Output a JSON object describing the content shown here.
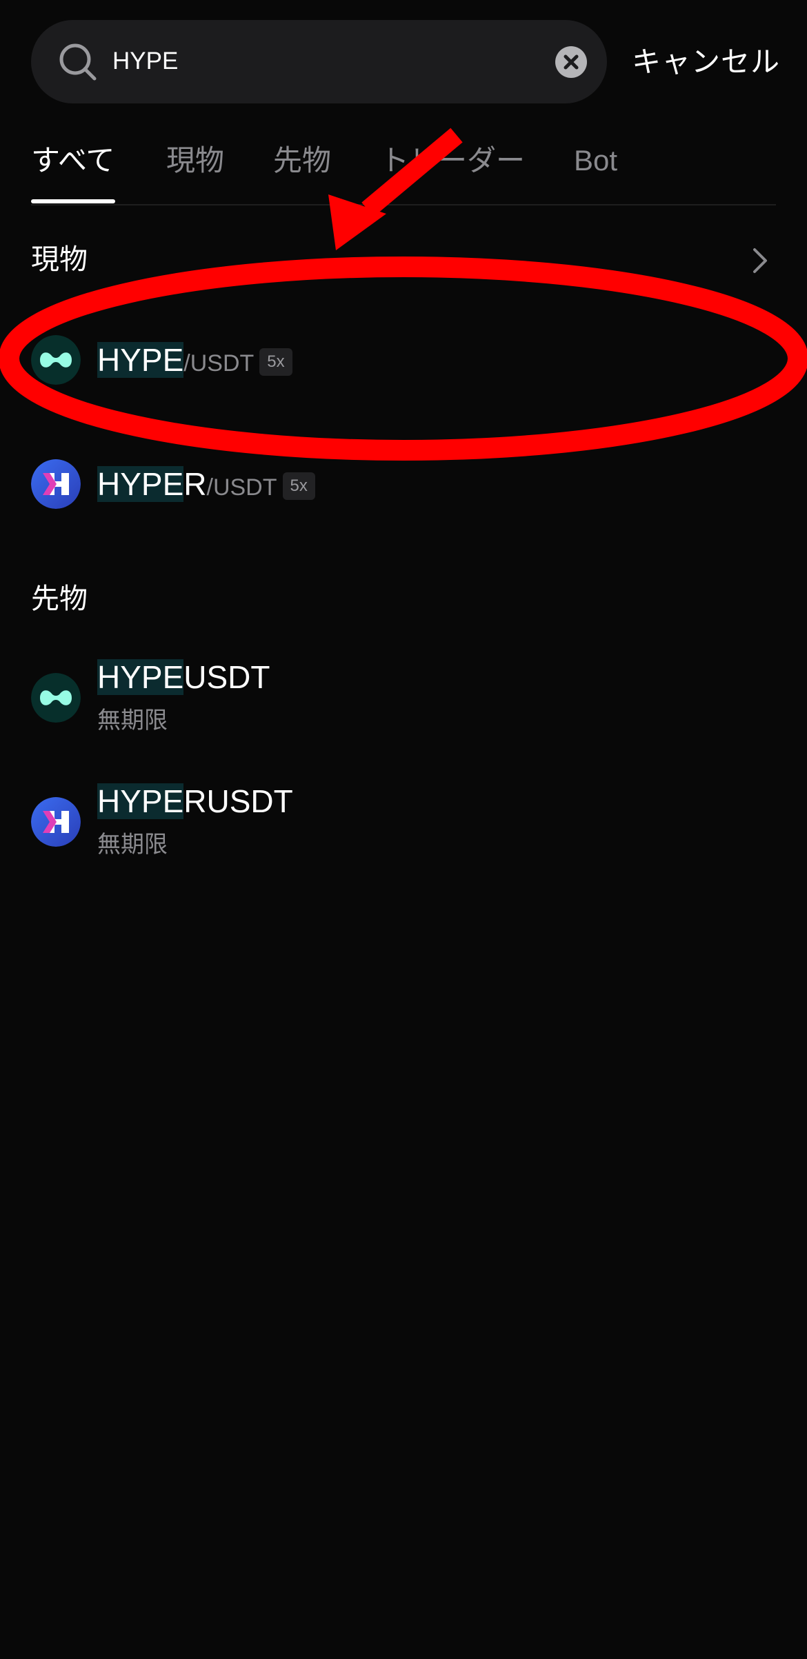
{
  "search": {
    "value": "HYPE",
    "cancel_label": "キャンセル"
  },
  "tabs": [
    {
      "label": "すべて",
      "active": true
    },
    {
      "label": "現物",
      "active": false
    },
    {
      "label": "先物",
      "active": false
    },
    {
      "label": "トレーダー",
      "active": false
    },
    {
      "label": "Bot",
      "active": false
    }
  ],
  "spot": {
    "title": "現物",
    "items": [
      {
        "highlight": "HYPE",
        "rest": "",
        "quote": "/USDT",
        "leverage": "5x",
        "icon": "hype-logo-icon"
      },
      {
        "highlight": "HYPE",
        "rest": "R",
        "quote": "/USDT",
        "leverage": "5x",
        "icon": "hyper-logo-icon"
      }
    ]
  },
  "futures": {
    "title": "先物",
    "items": [
      {
        "highlight": "HYPE",
        "rest": "USDT",
        "subtitle": "無期限",
        "icon": "hype-logo-icon"
      },
      {
        "highlight": "HYPE",
        "rest": "RUSDT",
        "subtitle": "無期限",
        "icon": "hyper-logo-icon"
      }
    ]
  },
  "colors": {
    "background": "#080808",
    "highlight_bg": "#0b2b2f",
    "muted_text": "#8a8a8e",
    "hype_mint": "#97fce4",
    "hyper_blue": "#2d4fd0",
    "annotation_red": "#ff0000"
  }
}
